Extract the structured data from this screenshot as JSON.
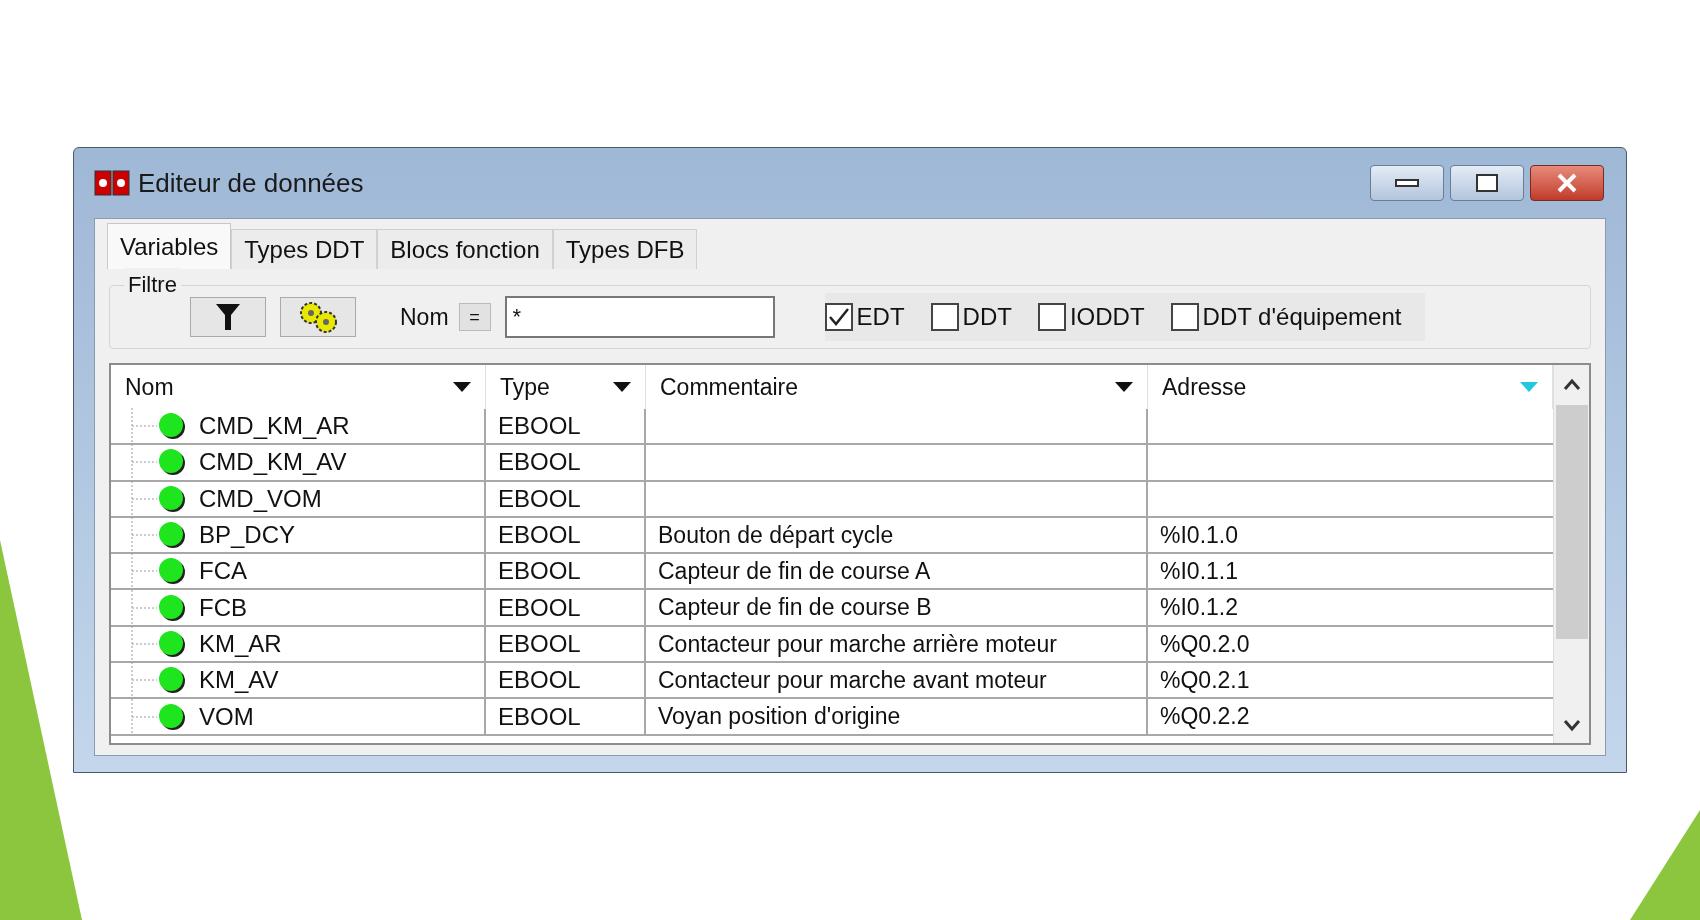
{
  "window": {
    "title": "Editeur de données"
  },
  "tabs": [
    {
      "label": "Variables",
      "selected": true
    },
    {
      "label": "Types DDT",
      "selected": false
    },
    {
      "label": "Blocs fonction",
      "selected": false
    },
    {
      "label": "Types DFB",
      "selected": false
    }
  ],
  "filter": {
    "title": "Filtre",
    "name_label": "Nom",
    "operator": "=",
    "name_value": "*",
    "checkboxes": [
      {
        "label": "EDT",
        "checked": true
      },
      {
        "label": "DDT",
        "checked": false
      },
      {
        "label": "IODDT",
        "checked": false
      },
      {
        "label": "DDT d'équipement",
        "checked": false
      }
    ]
  },
  "table": {
    "columns": [
      "Nom",
      "Type",
      "Commentaire",
      "Adresse"
    ],
    "rows": [
      {
        "name": "CMD_KM_AR",
        "type": "EBOOL",
        "comment": "",
        "address": ""
      },
      {
        "name": "CMD_KM_AV",
        "type": "EBOOL",
        "comment": "",
        "address": ""
      },
      {
        "name": "CMD_VOM",
        "type": "EBOOL",
        "comment": "",
        "address": ""
      },
      {
        "name": "BP_DCY",
        "type": "EBOOL",
        "comment": "Bouton de départ cycle",
        "address": "%I0.1.0"
      },
      {
        "name": "FCA",
        "type": "EBOOL",
        "comment": "Capteur de fin de course A",
        "address": "%I0.1.1"
      },
      {
        "name": "FCB",
        "type": "EBOOL",
        "comment": "Capteur de fin de course B",
        "address": "%I0.1.2"
      },
      {
        "name": "KM_AR",
        "type": "EBOOL",
        "comment": "Contacteur pour marche arrière moteur",
        "address": "%Q0.2.0"
      },
      {
        "name": "KM_AV",
        "type": "EBOOL",
        "comment": "Contacteur pour marche avant moteur",
        "address": "%Q0.2.1"
      },
      {
        "name": "VOM",
        "type": "EBOOL",
        "comment": "Voyan position d'origine",
        "address": "%Q0.2.2"
      }
    ]
  }
}
